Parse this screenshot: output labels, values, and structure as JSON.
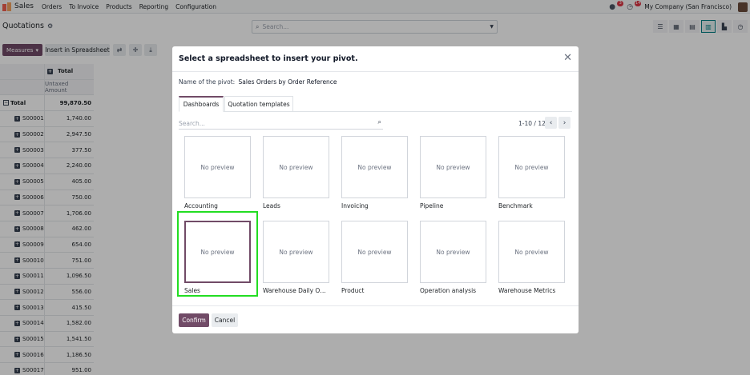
{
  "navbar": {
    "app_name": "Sales",
    "menu": [
      "Orders",
      "To Invoice",
      "Products",
      "Reporting",
      "Configuration"
    ],
    "messages_badge": "3",
    "activities_badge": "14",
    "company": "My Company (San Francisco)"
  },
  "control": {
    "breadcrumb": "Quotations",
    "search_placeholder": "Search..."
  },
  "toolbar": {
    "measures_label": "Measures",
    "insert_label": "Insert in Spreadsheet"
  },
  "pivot": {
    "header_total": "Total",
    "measure": "Untaxed Amount",
    "total_label": "Total",
    "total_value": "99,870.50",
    "rows": [
      {
        "ref": "S00001",
        "value": "1,740.00"
      },
      {
        "ref": "S00002",
        "value": "2,947.50"
      },
      {
        "ref": "S00003",
        "value": "377.50"
      },
      {
        "ref": "S00004",
        "value": "2,240.00"
      },
      {
        "ref": "S00005",
        "value": "405.00"
      },
      {
        "ref": "S00006",
        "value": "750.00"
      },
      {
        "ref": "S00007",
        "value": "1,706.00"
      },
      {
        "ref": "S00008",
        "value": "462.00"
      },
      {
        "ref": "S00009",
        "value": "654.00"
      },
      {
        "ref": "S00010",
        "value": "751.00"
      },
      {
        "ref": "S00011",
        "value": "1,096.50"
      },
      {
        "ref": "S00012",
        "value": "556.00"
      },
      {
        "ref": "S00013",
        "value": "415.50"
      },
      {
        "ref": "S00014",
        "value": "1,582.00"
      },
      {
        "ref": "S00015",
        "value": "1,541.50"
      },
      {
        "ref": "S00016",
        "value": "1,186.50"
      },
      {
        "ref": "S00017",
        "value": "951.00"
      }
    ]
  },
  "modal": {
    "title": "Select a spreadsheet to insert your pivot.",
    "pivot_name_label": "Name of the pivot:",
    "pivot_name_value": "Sales Orders by Order Reference",
    "tabs": [
      "Dashboards",
      "Quotation templates"
    ],
    "search_placeholder": "Search...",
    "pager": "1-10 / 12",
    "preview_text": "No preview",
    "items": [
      "Accounting",
      "Leads",
      "Invoicing",
      "Pipeline",
      "Benchmark",
      "Sales",
      "Warehouse Daily Operations",
      "Product",
      "Operation analysis",
      "Warehouse Metrics"
    ],
    "confirm_label": "Confirm",
    "cancel_label": "Cancel"
  },
  "colors": {
    "primary": "#714b67",
    "highlight": "#22dd22"
  }
}
